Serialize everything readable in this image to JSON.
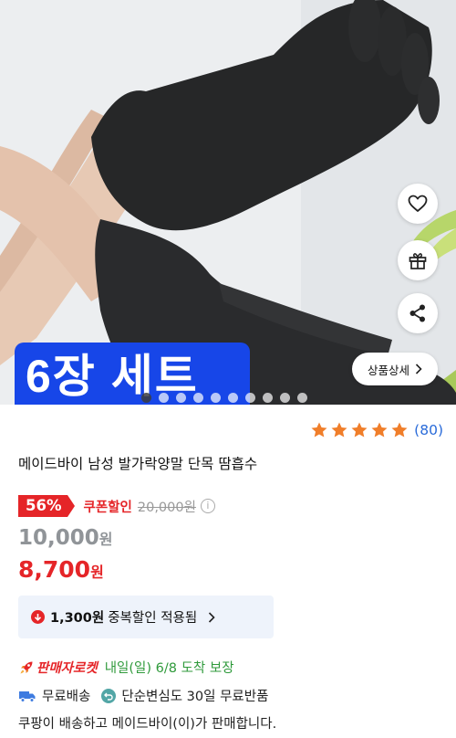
{
  "hero": {
    "badge_text": "6장 세트",
    "detail_label": "상품상세",
    "dot_count": 10,
    "active_dot": 0
  },
  "product": {
    "rating_stars": 5,
    "review_count": "(80)",
    "title": "메이드바이 남성 발가락양말 단목 땀흡수",
    "discount_rate": "56%",
    "coupon_label": "쿠폰할인",
    "original_price": "20,000원",
    "info_icon": "i",
    "price_before": "10,000",
    "price_final": "8,700",
    "won": "원",
    "multi_discount_amount": "1,300원",
    "multi_discount_text": "중복할인 적용됨",
    "rocket_label": "판매자로켓",
    "delivery_text": "내일(일) 6/8 도착 보장",
    "free_shipping": "무료배송",
    "free_return": "단순변심도 30일 무료반품",
    "seller_text": "쿠팡이 배송하고 메이드바이(이)가 판매합니다."
  },
  "colors": {
    "accent_red": "#e52528",
    "star": "#f07e2a",
    "link_blue": "#2a6bd9",
    "delivery_green": "#2f9a3b",
    "badge_blue": "#1746e8"
  },
  "icons": [
    "heart-icon",
    "gift-icon",
    "share-icon",
    "chevron-right-icon",
    "star-icon",
    "arrow-down-icon",
    "rocket-icon",
    "truck-icon",
    "return-icon",
    "info-icon"
  ]
}
